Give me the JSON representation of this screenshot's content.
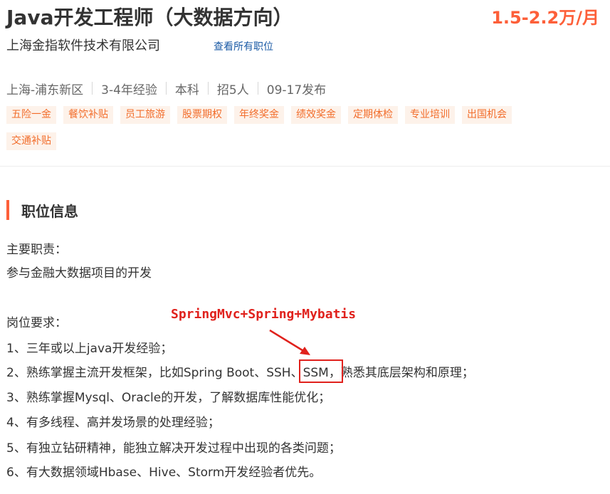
{
  "job": {
    "title": "Java开发工程师（大数据方向）",
    "salary": "1.5-2.2万/月",
    "company": "上海金指软件技术有限公司",
    "all_jobs_link": "查看所有职位"
  },
  "meta": {
    "location": "上海-浦东新区",
    "experience": "3-4年经验",
    "education": "本科",
    "headcount": "招5人",
    "published": "09-17发布"
  },
  "benefits": [
    "五险一金",
    "餐饮补贴",
    "员工旅游",
    "股票期权",
    "年终奖金",
    "绩效奖金",
    "定期体检",
    "专业培训",
    "出国机会",
    "交通补贴"
  ],
  "section": {
    "title": "职位信息"
  },
  "description": {
    "duties_heading": "主要职责：",
    "duty_1": "参与金融大数据项目的开发",
    "requirements_heading": "岗位要求：",
    "req_1": "1、三年或以上java开发经验；",
    "req_2_prefix": "2、熟练掌握主流开发框架，比如Spring Boot、SSH、",
    "req_2_highlight": "SSM，",
    "req_2_suffix": "熟悉其底层架构和原理；",
    "req_3": "3、熟练掌握Mysql、Oracle的开发，了解数据库性能优化；",
    "req_4": "4、有多线程、高并发场景的处理经验；",
    "req_5": "5、有独立钻研精神，能独立解决开发过程中出现的各类问题；",
    "req_6": "6、有大数据领域Hbase、Hive、Storm开发经验者优先。"
  },
  "annotation": {
    "text": "SpringMvc+Spring+Mybatis",
    "color": "#e0211c"
  },
  "colors": {
    "accent": "#fd5f39",
    "tag_bg": "#fdf2ea",
    "tag_text": "#f26d2b",
    "link": "#1a5aa5"
  }
}
